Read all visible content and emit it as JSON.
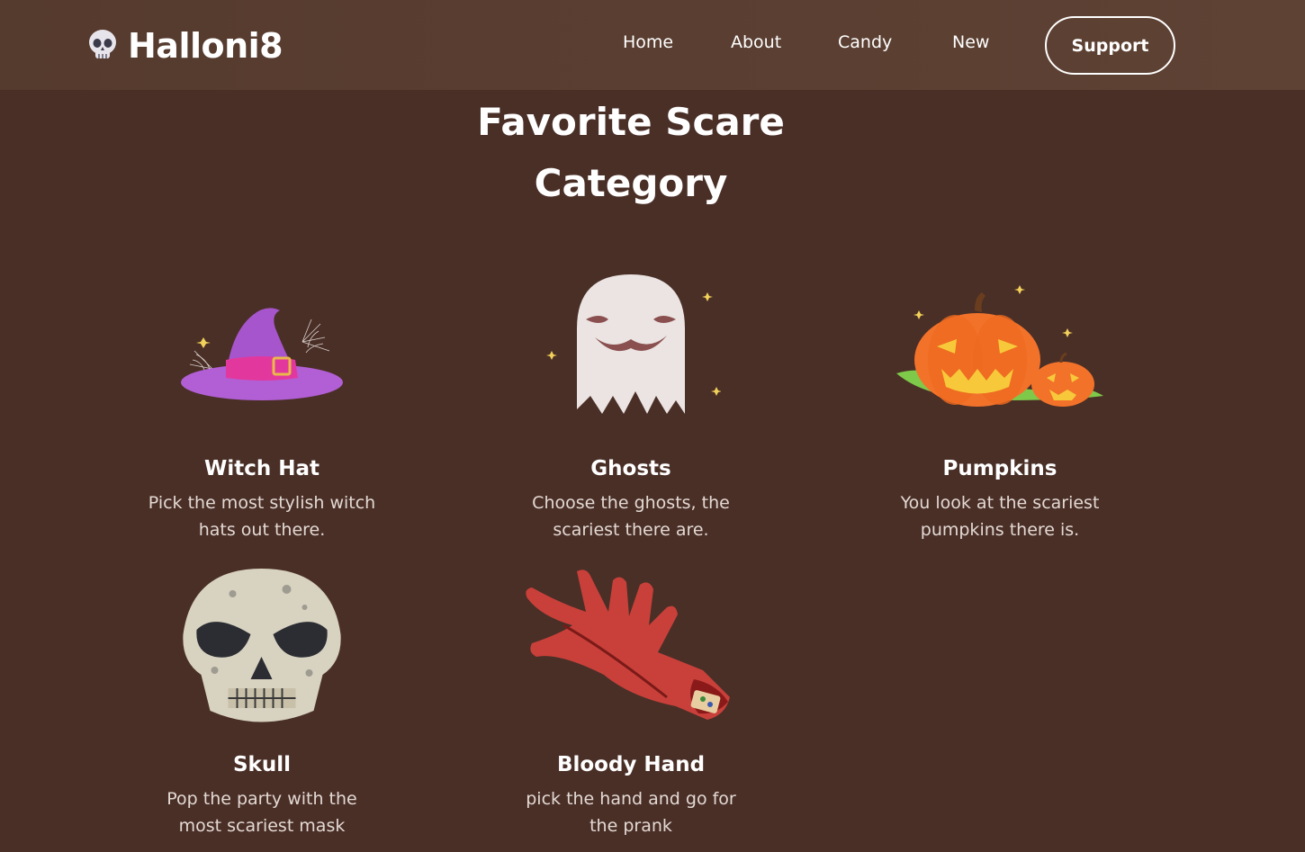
{
  "header": {
    "brand": "Halloni8",
    "nav": [
      "Home",
      "About",
      "Candy",
      "New"
    ],
    "cta": "Support"
  },
  "section": {
    "title_line1": "Favorite Scare",
    "title_line2": "Category"
  },
  "categories": [
    {
      "title": "Witch Hat",
      "description": "Pick the most stylish witch hats out there.",
      "icon": "witch-hat-icon"
    },
    {
      "title": "Ghosts",
      "description": "Choose the ghosts, the scariest there are.",
      "icon": "ghost-icon"
    },
    {
      "title": "Pumpkins",
      "description": "You look at the scariest pumpkins there is.",
      "icon": "pumpkin-icon"
    },
    {
      "title": "Skull",
      "description": "Pop the party with the most scariest mask",
      "icon": "skull-icon"
    },
    {
      "title": "Bloody Hand",
      "description": "pick the hand and go for the prank",
      "icon": "bloody-hand-icon"
    }
  ],
  "colors": {
    "background": "#4a2f27",
    "navbar": "#5a3d30",
    "text": "#ffffff",
    "muted_text": "#e3d9d3"
  }
}
